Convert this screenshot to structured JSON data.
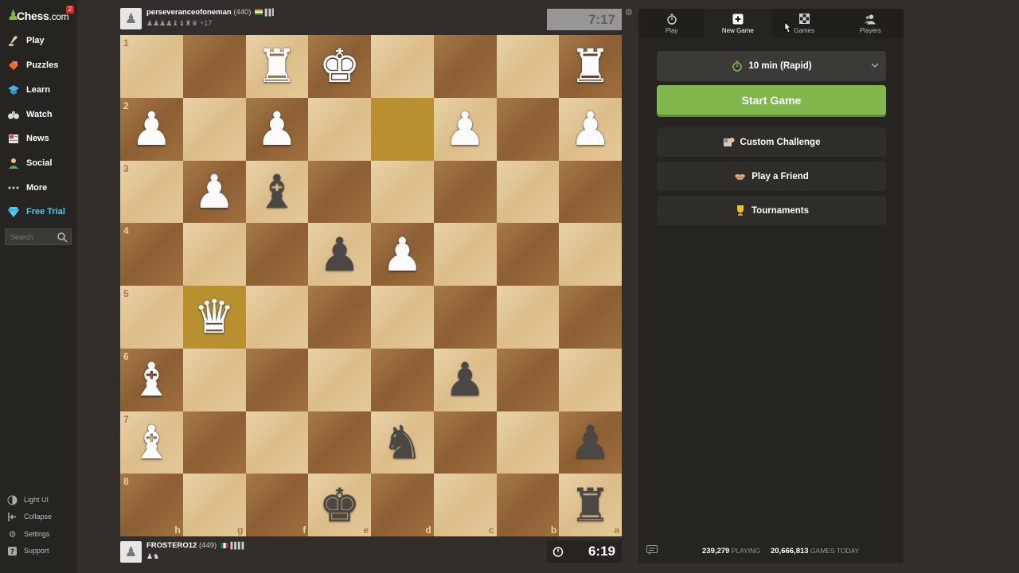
{
  "sidebar": {
    "logo": {
      "word": "Chess",
      "suffix": ".com",
      "notification": "2"
    },
    "items": [
      {
        "label": "Play",
        "icon": "play-pawn-icon"
      },
      {
        "label": "Puzzles",
        "icon": "puzzle-icon"
      },
      {
        "label": "Learn",
        "icon": "learn-cap-icon"
      },
      {
        "label": "Watch",
        "icon": "binoculars-icon"
      },
      {
        "label": "News",
        "icon": "newspaper-icon"
      },
      {
        "label": "Social",
        "icon": "social-people-icon"
      },
      {
        "label": "More",
        "icon": "more-dots-icon"
      },
      {
        "label": "Free Trial",
        "icon": "diamond-icon"
      }
    ],
    "search": {
      "placeholder": "Search"
    },
    "bottom": [
      {
        "label": "Light UI",
        "icon": "contrast-icon"
      },
      {
        "label": "Collapse",
        "icon": "collapse-icon"
      },
      {
        "label": "Settings",
        "icon": "gear-icon"
      },
      {
        "label": "Support",
        "icon": "help-icon"
      }
    ]
  },
  "top_player": {
    "name": "perseveranceofoneman",
    "rating": "(440)",
    "captured": "♟♟♟♟♝♝♜♛",
    "advantage": "+17",
    "clock": "7:17"
  },
  "bottom_player": {
    "name": "FROSTERO12",
    "rating": "(449)",
    "captured": "♟♞",
    "clock": "6:19"
  },
  "board": {
    "ranks": [
      "1",
      "2",
      "3",
      "4",
      "5",
      "6",
      "7",
      "8"
    ],
    "files": [
      "h",
      "g",
      "f",
      "e",
      "d",
      "c",
      "b",
      "a"
    ],
    "pieces": [
      [
        "",
        "",
        "wR",
        "wK",
        "",
        "",
        "",
        "wR"
      ],
      [
        "wP",
        "",
        "wP",
        "",
        "",
        "wP",
        "",
        "wP"
      ],
      [
        "",
        "wP",
        "bB",
        "",
        "",
        "",
        "",
        ""
      ],
      [
        "",
        "",
        "",
        "bP",
        "wP",
        "",
        "",
        ""
      ],
      [
        "",
        "wQ",
        "",
        "",
        "",
        "",
        "",
        ""
      ],
      [
        "wB",
        "",
        "",
        "",
        "",
        "bP",
        "",
        ""
      ],
      [
        "wB",
        "",
        "",
        "",
        "bN",
        "",
        "",
        "bP"
      ],
      [
        "",
        "",
        "",
        "bK",
        "",
        "",
        "",
        "bR"
      ]
    ],
    "highlights": [
      [
        1,
        4
      ],
      [
        4,
        1
      ]
    ]
  },
  "panel": {
    "tabs": [
      {
        "label": "Play",
        "icon": "stopwatch-icon",
        "active": false
      },
      {
        "label": "New Game",
        "icon": "plus-square-icon",
        "active": true
      },
      {
        "label": "Games",
        "icon": "board-icon",
        "active": false
      },
      {
        "label": "Players",
        "icon": "players-icon",
        "active": false
      }
    ],
    "time_control": "10 min (Rapid)",
    "start": "Start Game",
    "custom": "Custom Challenge",
    "friend": "Play a Friend",
    "tournaments": "Tournaments",
    "playing_count": "239,279",
    "playing_label": "PLAYING",
    "games_count": "20,666,813",
    "games_label": "GAMES TODAY"
  },
  "colors": {
    "accent_green": "#81b64c",
    "trial_blue": "#4fc8f0",
    "bg": "#312e2b"
  }
}
